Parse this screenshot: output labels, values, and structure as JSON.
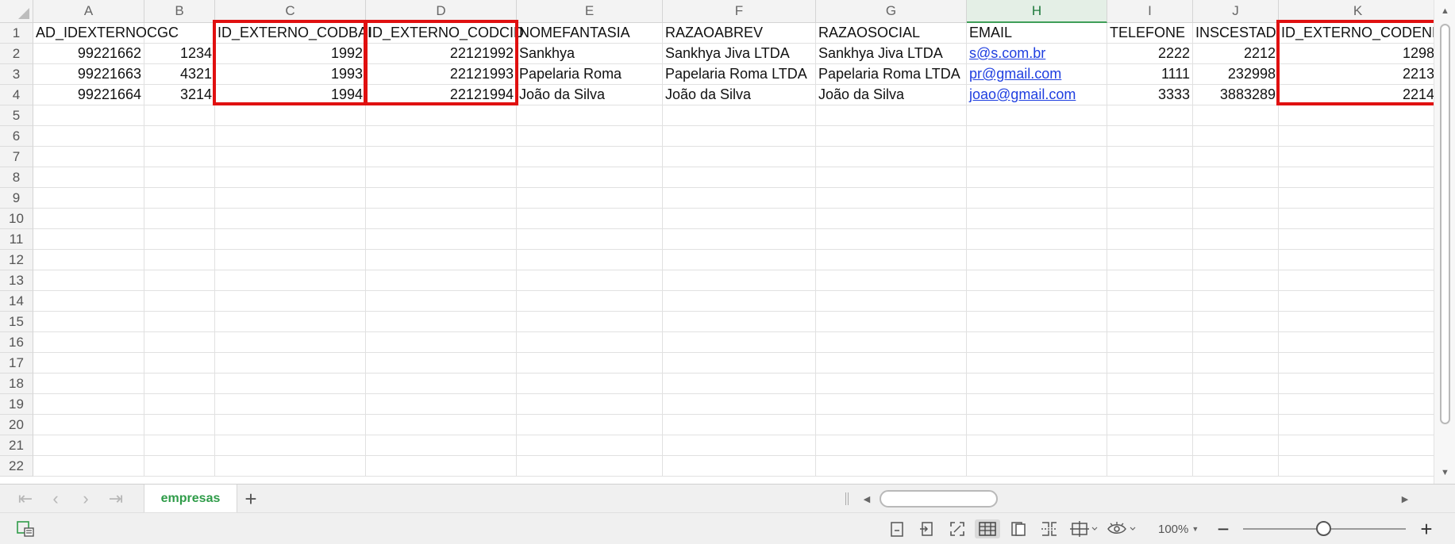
{
  "columns": [
    "A",
    "B",
    "C",
    "D",
    "E",
    "F",
    "G",
    "H",
    "I",
    "J",
    "K"
  ],
  "active_column": "H",
  "rows": [
    "1",
    "2",
    "3",
    "4",
    "5",
    "6",
    "7",
    "8",
    "9",
    "10",
    "11",
    "12",
    "13",
    "14",
    "15",
    "16",
    "17",
    "18",
    "19",
    "20",
    "21",
    "22"
  ],
  "cells": {
    "header": [
      "AD_IDEXTERNO",
      "CGC",
      "ID_EXTERNO_CODBAI",
      "ID_EXTERNO_CODCID",
      "NOMEFANTASIA",
      "RAZAOABREV",
      "RAZAOSOCIAL",
      "EMAIL",
      "TELEFONE",
      "INSCESTAD",
      "ID_EXTERNO_CODEND"
    ],
    "data": [
      [
        "99221662",
        "1234",
        "1992",
        "22121992",
        "Sankhya",
        "Sankhya Jiva LTDA",
        "Sankhya Jiva LTDA",
        "s@s.com.br",
        "2222",
        "2212",
        "1298"
      ],
      [
        "99221663",
        "4321",
        "1993",
        "22121993",
        "Papelaria Roma",
        "Papelaria Roma LTDA",
        "Papelaria Roma LTDA",
        "pr@gmail.com",
        "1111",
        "232998",
        "2213"
      ],
      [
        "99221664",
        "3214",
        "1994",
        "22121994",
        "João da Silva",
        "João da Silva",
        "João da Silva",
        "joao@gmail.com",
        "3333",
        "3883289",
        "2214"
      ]
    ]
  },
  "highlighted_columns": [
    "C",
    "D",
    "K"
  ],
  "highlight_color": "#e01010",
  "link_color": "#1f3fe0",
  "sheet_tabs": [
    "empresas"
  ],
  "active_sheet": "empresas",
  "sheet_tab_color": "#2f9c49",
  "zoom": {
    "label": "100%",
    "value_percent": 100
  },
  "status_icons": [
    "macro-icon",
    "page-layout-icon",
    "export-icon",
    "fullscreen-icon",
    "normal-view-icon",
    "page-view-icon",
    "page-break-icon",
    "freeze-icon",
    "eye-protection-icon"
  ]
}
